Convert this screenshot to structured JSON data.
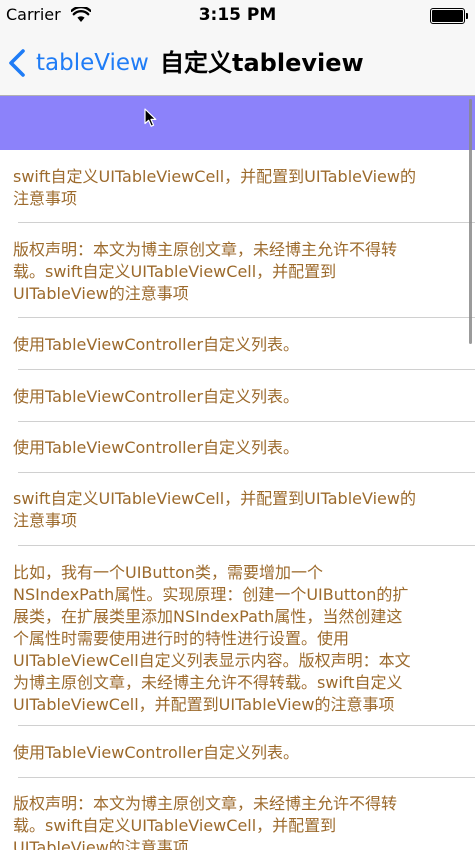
{
  "status_bar": {
    "carrier": "Carrier",
    "time": "3:15 PM"
  },
  "nav_bar": {
    "back_label": "tableView",
    "title": "自定义tableview",
    "accent_color": "#1f7cf6"
  },
  "table": {
    "header_color": "#8c82fa",
    "text_color": "#9c6a2c",
    "cells": [
      {
        "text": "swift自定义UITableViewCell，并配置到UITableView的\n注意事项"
      },
      {
        "text": "版权声明：本文为博主原创文章，未经博主允许不得转\n载。swift自定义UITableViewCell，并配置到\nUITableView的注意事项"
      },
      {
        "text": "使用TableViewController自定义列表。"
      },
      {
        "text": "使用TableViewController自定义列表。"
      },
      {
        "text": "使用TableViewController自定义列表。"
      },
      {
        "text": "swift自定义UITableViewCell，并配置到UITableView的\n注意事项"
      },
      {
        "text": "比如，我有一个UIButton类，需要增加一个\nNSIndexPath属性。实现原理：创建一个UIButton的扩\n展类，在扩展类里添加NSIndexPath属性，当然创建这\n个属性时需要使用进行时的特性进行设置。使用\nUITableViewCell自定义列表显示内容。版权声明：本文\n为博主原创文章，未经博主允许不得转载。swift自定义\nUITableViewCell，并配置到UITableView的注意事项"
      },
      {
        "text": "使用TableViewController自定义列表。"
      },
      {
        "text": "版权声明：本文为博主原创文章，未经博主允许不得转\n载。swift自定义UITableViewCell，并配置到\nUITableView的注意事项"
      }
    ]
  }
}
